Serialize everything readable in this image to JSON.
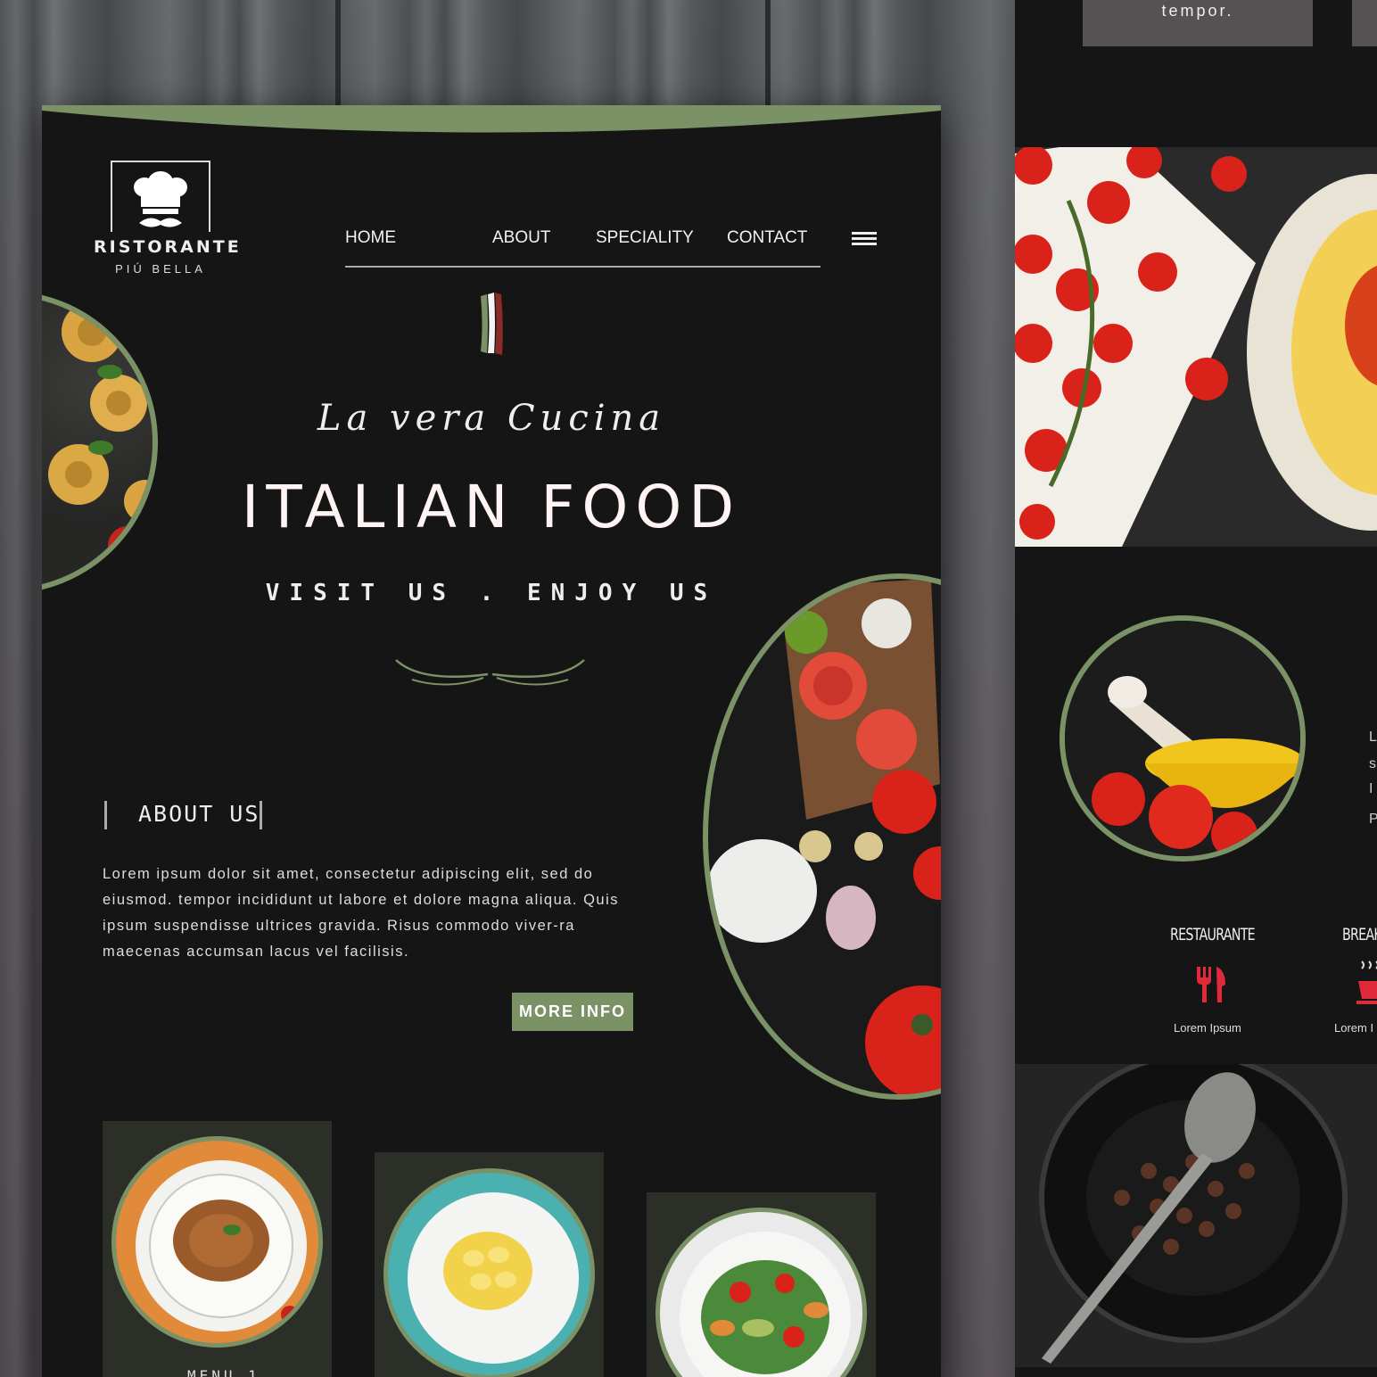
{
  "main_page": {
    "brand": {
      "name": "RISTORANTE",
      "sub": "PIÚ BELLA"
    },
    "nav": {
      "home": "HOME",
      "about": "ABOUT",
      "speciality": "SPECIALITY",
      "contact": "CONTACT"
    },
    "hero": {
      "script": "La vera Cucina",
      "title": "ITALIAN FOOD",
      "tagline": "VISIT US . ENJOY US"
    },
    "about": {
      "heading": "ABOUT US",
      "text": "Lorem ipsum dolor sit amet, consectetur adipiscing elit, sed do eiusmod. tempor incididunt ut labore et dolore magna aliqua. Quis ipsum suspendisse ultrices gravida. Risus commodo viver-ra maecenas accumsan lacus vel facilisis.",
      "button": "MORE INFO"
    },
    "menu": [
      {
        "label": "MENU 1"
      }
    ]
  },
  "side_page": {
    "tempor_text": "tempor.",
    "features": [
      {
        "title": "RESTAURANTE",
        "sub": "Lorem Ipsum"
      },
      {
        "title": "BREAK",
        "sub": "Lorem I"
      }
    ],
    "edge_letters": [
      "L",
      "s",
      "I",
      "P"
    ]
  },
  "colors": {
    "accent_green": "#7b9166",
    "page_bg": "#151515",
    "card_bg": "#2c2e28"
  },
  "icons": [
    "chef-hat-logo-icon",
    "hamburger-menu-icon",
    "italian-flag-icon",
    "ornament-divider-icon",
    "fork-knife-icon",
    "coffee-cup-icon"
  ]
}
